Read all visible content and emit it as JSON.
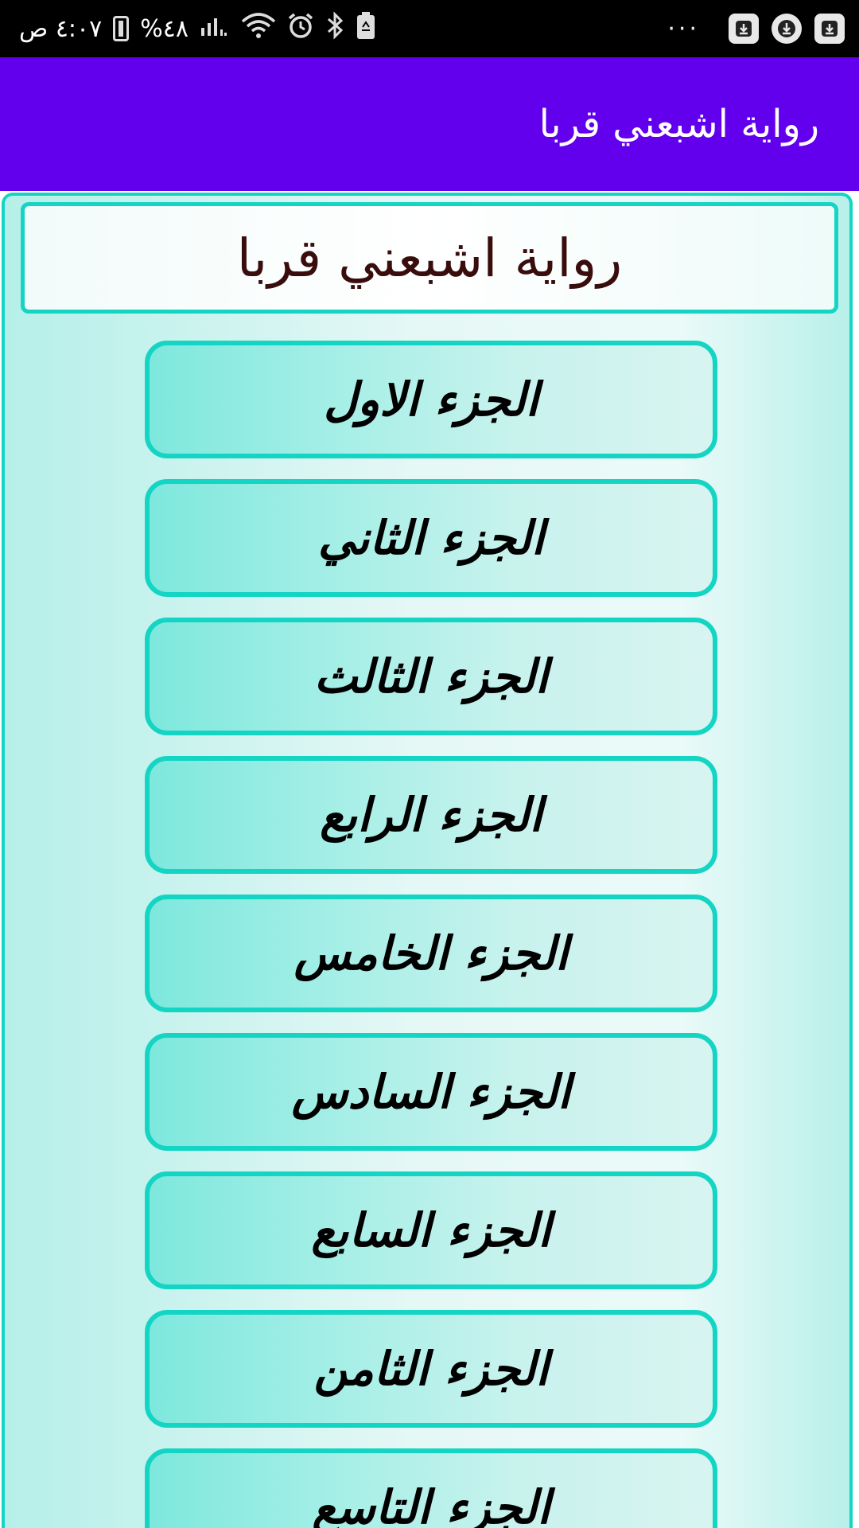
{
  "status_bar": {
    "time": "٤:٠٧ ص",
    "battery_percent": "%٤٨",
    "more_dots": "···"
  },
  "app_bar": {
    "title": "رواية اشبعني قربا"
  },
  "content": {
    "header": "رواية اشبعني قربا",
    "parts": [
      "الجزء الاول",
      "الجزء الثاني",
      "الجزء الثالث",
      "الجزء الرابع",
      "الجزء الخامس",
      "الجزء السادس",
      "الجزء السابع",
      "الجزء الثامن",
      "الجزء التاسع"
    ]
  },
  "colors": {
    "app_bar": "#6200ee",
    "accent_border": "#14d5c3",
    "header_text": "#3a0d0d"
  },
  "icons": {
    "status": [
      "charging-battery-icon",
      "signal-icon",
      "wifi-icon",
      "alarm-icon",
      "bluetooth-icon",
      "battery-saver-icon"
    ],
    "notifications": [
      "download-icon",
      "download-icon",
      "download-icon"
    ]
  }
}
